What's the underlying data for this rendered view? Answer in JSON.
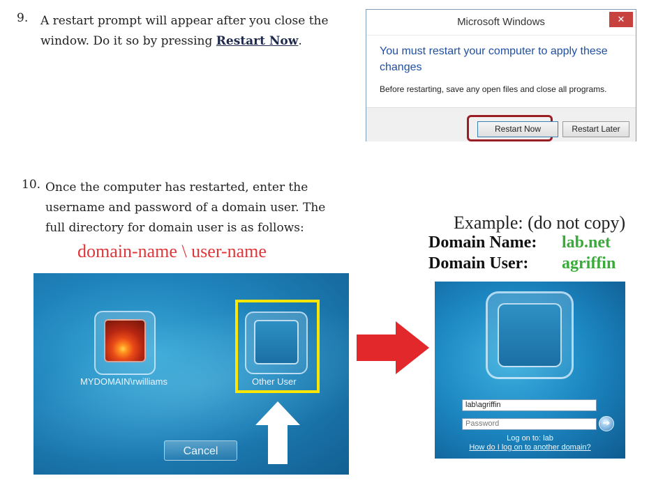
{
  "step9": {
    "number": "9.",
    "line1": "A restart prompt will appear after you close the",
    "line2_prefix": "window. Do it so by pressing ",
    "line2_bold": "Restart Now",
    "line2_suffix": "."
  },
  "dialog": {
    "title": "Microsoft Windows",
    "close_glyph": "✕",
    "heading": "You must restart your computer to apply these changes",
    "body": "Before restarting, save any open files and close all programs.",
    "restart_now_label": "Restart Now",
    "restart_later_label": "Restart Later"
  },
  "step10": {
    "number": "10.",
    "line1": "Once the computer has restarted, enter the",
    "line2": "username and password of a domain user. The",
    "line3": "full directory for domain user is as follows:",
    "format": "domain-name \\ user-name"
  },
  "example": {
    "heading": "Example: (do not copy)",
    "domain_name_label": "Domain Name:",
    "domain_name_value": "lab.net",
    "domain_user_label": "Domain User:",
    "domain_user_value": "agriffin"
  },
  "login_select": {
    "user1_label": "MYDOMAIN\\rwilliams",
    "user2_label": "Other User",
    "cancel_label": "Cancel"
  },
  "login_form": {
    "username_value": "lab\\agriffin",
    "password_placeholder": "Password",
    "logon_to": "Log on to: lab",
    "another_domain_link": "How do I log on to another domain?"
  },
  "colors": {
    "red_arrow": "#e3282b",
    "highlight_yellow": "#ffe600",
    "ring_red": "#9b1c22",
    "green_value": "#3aab3a"
  }
}
